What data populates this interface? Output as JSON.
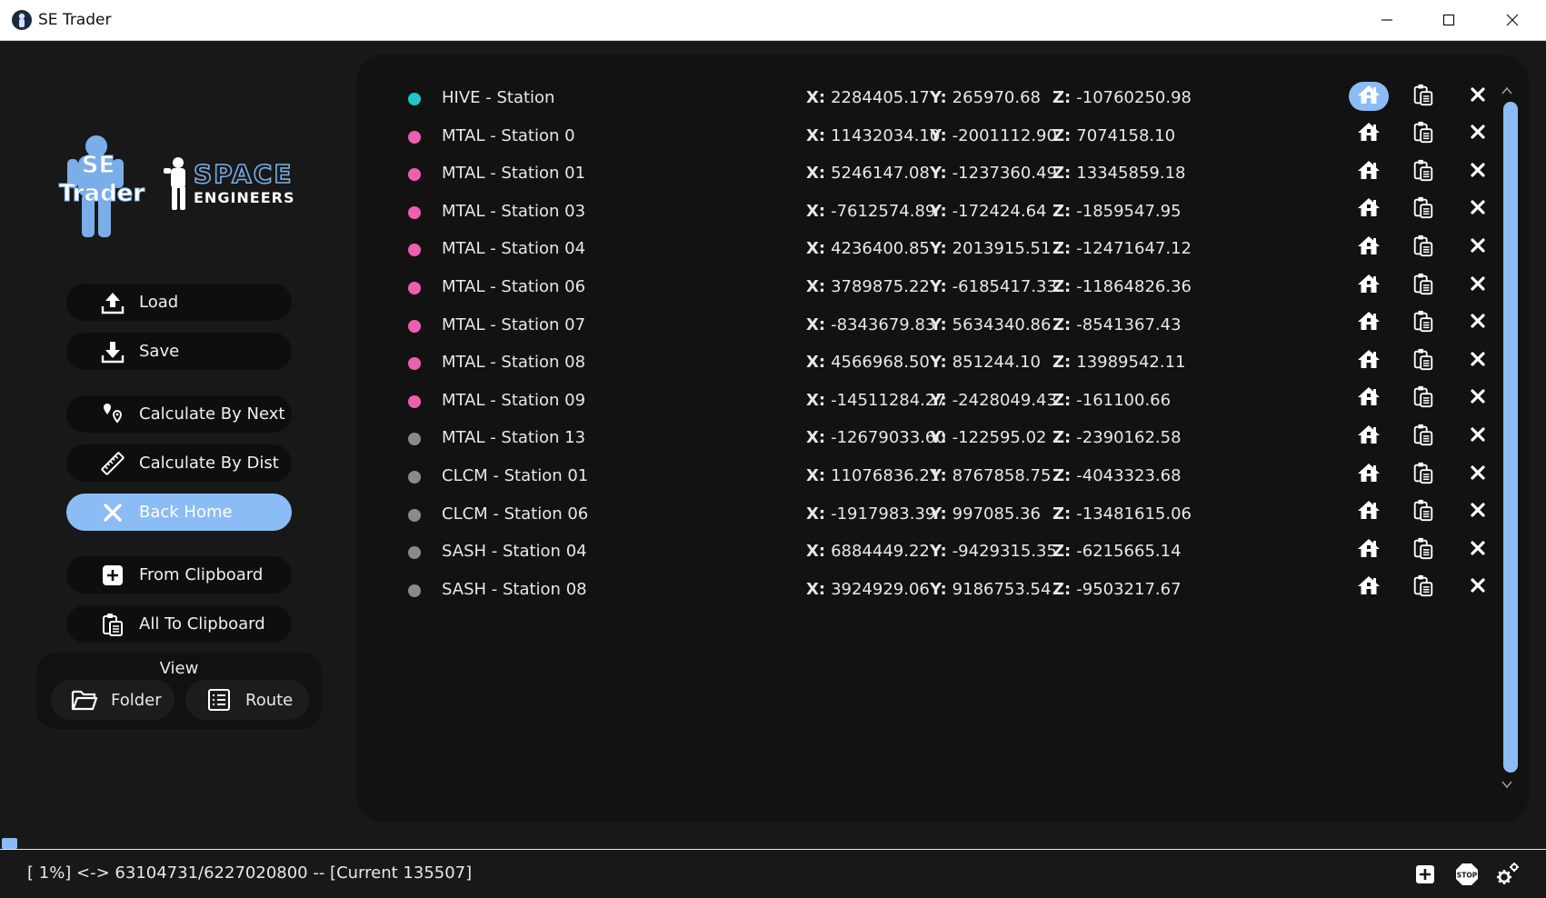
{
  "window": {
    "title": "SE Trader"
  },
  "logo": {
    "line1": "SE",
    "line2": "Trader",
    "brand1": "SPACE",
    "brand2": "ENGINEERS"
  },
  "sidebar": {
    "load": "Load",
    "save": "Save",
    "calc_next": "Calculate By Next",
    "calc_dist": "Calculate By Dist",
    "back_home": "Back Home",
    "from_clipboard": "From Clipboard",
    "all_to_clipboard": "All To Clipboard",
    "view": {
      "label": "View",
      "folder": "Folder",
      "route": "Route"
    }
  },
  "coord_labels": {
    "x": "X:",
    "y": "Y:",
    "z": "Z:"
  },
  "colors": {
    "accent": "#8cbcf5",
    "cyan": "#1fc5c8",
    "pink": "#ef5fb1",
    "gray": "#8a8a8a"
  },
  "stations": [
    {
      "name": "HIVE - Station",
      "x": "2284405.17",
      "y": "265970.68",
      "z": "-10760250.98",
      "dot": "cyan",
      "home": true
    },
    {
      "name": "MTAL - Station 0",
      "x": "11432034.10",
      "y": "-2001112.90",
      "z": "7074158.10",
      "dot": "pink",
      "home": false
    },
    {
      "name": "MTAL - Station 01",
      "x": "5246147.08",
      "y": "-1237360.49",
      "z": "13345859.18",
      "dot": "pink",
      "home": false
    },
    {
      "name": "MTAL - Station 03",
      "x": "-7612574.89",
      "y": "-172424.64",
      "z": "-1859547.95",
      "dot": "pink",
      "home": false
    },
    {
      "name": "MTAL - Station 04",
      "x": "4236400.85",
      "y": "2013915.51",
      "z": "-12471647.12",
      "dot": "pink",
      "home": false
    },
    {
      "name": "MTAL - Station 06",
      "x": "3789875.22",
      "y": "-6185417.33",
      "z": "-11864826.36",
      "dot": "pink",
      "home": false
    },
    {
      "name": "MTAL - Station 07",
      "x": "-8343679.83",
      "y": "5634340.86",
      "z": "-8541367.43",
      "dot": "pink",
      "home": false
    },
    {
      "name": "MTAL - Station 08",
      "x": "4566968.50",
      "y": "851244.10",
      "z": "13989542.11",
      "dot": "pink",
      "home": false
    },
    {
      "name": "MTAL - Station 09",
      "x": "-14511284.27",
      "y": "-2428049.43",
      "z": "-161100.66",
      "dot": "pink",
      "home": false
    },
    {
      "name": "MTAL - Station 13",
      "x": "-12679033.60",
      "y": "-122595.02",
      "z": "-2390162.58",
      "dot": "gray",
      "home": false
    },
    {
      "name": "CLCM - Station 01",
      "x": "11076836.21",
      "y": "8767858.75",
      "z": "-4043323.68",
      "dot": "gray",
      "home": false
    },
    {
      "name": "CLCM - Station 06",
      "x": "-1917983.39",
      "y": "997085.36",
      "z": "-13481615.06",
      "dot": "gray",
      "home": false
    },
    {
      "name": "SASH - Station 04",
      "x": "6884449.22",
      "y": "-9429315.35",
      "z": "-6215665.14",
      "dot": "gray",
      "home": false
    },
    {
      "name": "SASH - Station 08",
      "x": "3924929.06",
      "y": "9186753.54",
      "z": "-9503217.67",
      "dot": "gray",
      "home": false
    }
  ],
  "progress": {
    "fraction": 0.01
  },
  "status": {
    "text": "[  1%] <-> 63104731/6227020800 -- [Current 135507]"
  }
}
